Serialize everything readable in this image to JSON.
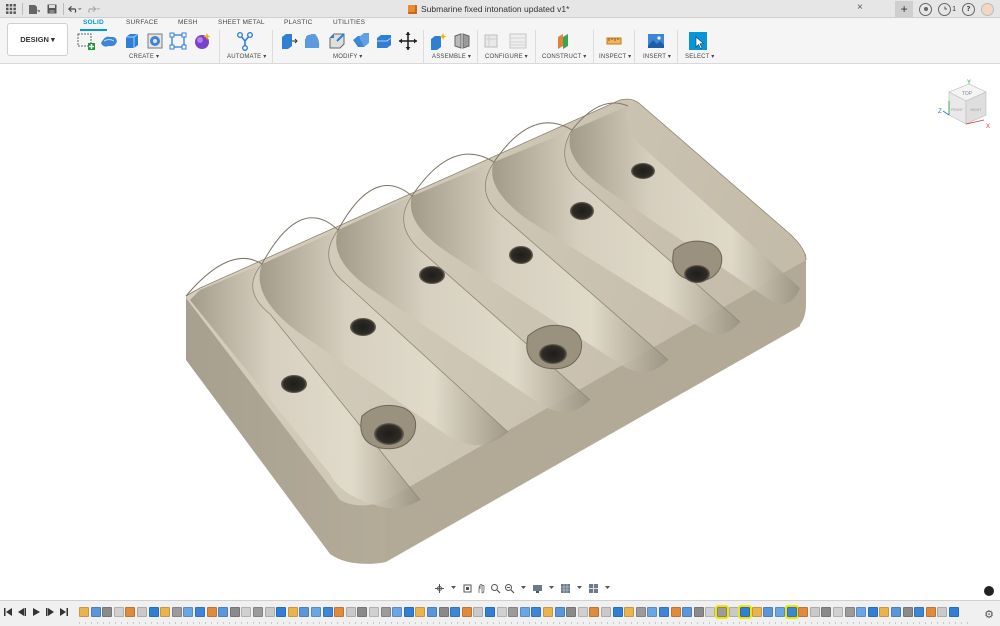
{
  "titlebar": {
    "document_title": "Submarine fixed intonation updated v1*",
    "close_glyph": "×",
    "plus_glyph": "+",
    "notification_count": "1",
    "help_glyph": "?"
  },
  "toolbar": {
    "workspace_label": "DESIGN ▾",
    "tabs": [
      {
        "label": "SOLID",
        "active": true
      },
      {
        "label": "SURFACE",
        "active": false
      },
      {
        "label": "MESH",
        "active": false
      },
      {
        "label": "SHEET METAL",
        "active": false
      },
      {
        "label": "PLASTIC",
        "active": false
      },
      {
        "label": "UTILITIES",
        "active": false
      }
    ],
    "groups": [
      {
        "label": "CREATE ▾"
      },
      {
        "label": "AUTOMATE ▾"
      },
      {
        "label": "MODIFY ▾"
      },
      {
        "label": "ASSEMBLE ▾"
      },
      {
        "label": "CONFIGURE ▾"
      },
      {
        "label": "CONSTRUCT ▾"
      },
      {
        "label": "INSPECT ▾"
      },
      {
        "label": "INSERT ▾"
      },
      {
        "label": "SELECT ▾"
      }
    ]
  },
  "viewcube": {
    "face_top": "TOP",
    "face_front": "FRONT",
    "face_right": "RIGHT",
    "axis_x": "X",
    "axis_y": "Y",
    "axis_z": "Z"
  },
  "colors": {
    "accent": "#0696d7",
    "part_light": "#d9d2c3",
    "part_mid": "#b9b09f",
    "part_dark": "#8e8676",
    "hole": "#2b2925",
    "timeline_highlight": "#f2e600"
  }
}
